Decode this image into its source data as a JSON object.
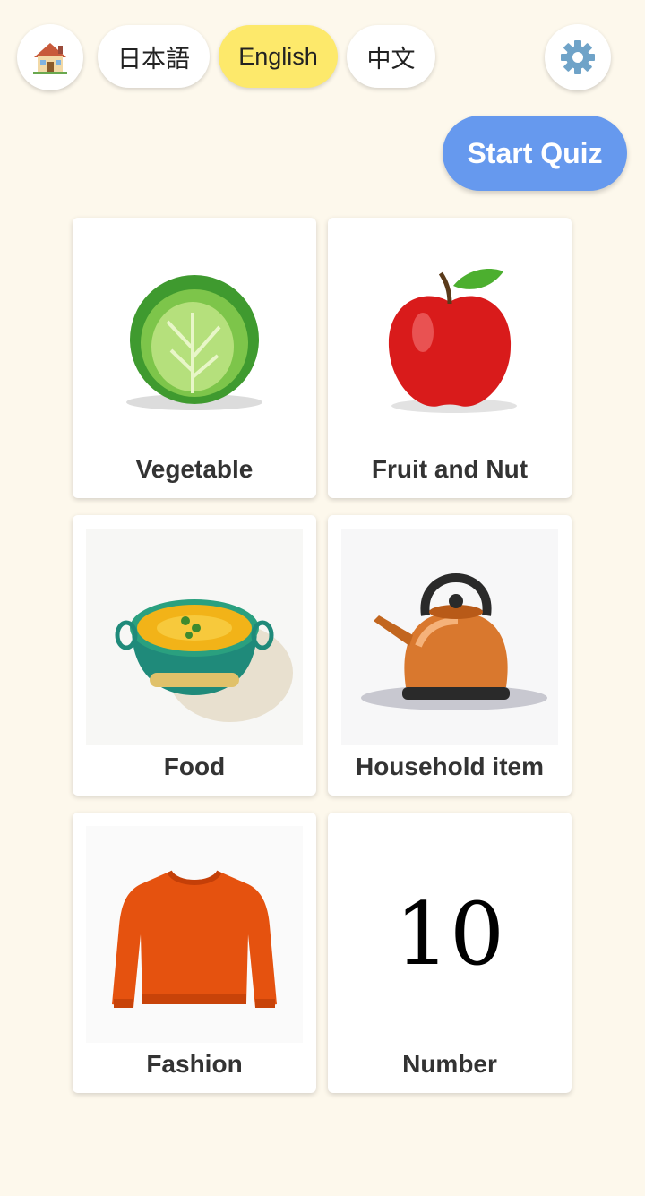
{
  "header": {
    "home_icon": "house-icon",
    "languages": [
      {
        "label": "日本語",
        "active": false
      },
      {
        "label": "English",
        "active": true
      },
      {
        "label": "中文",
        "active": false
      }
    ],
    "settings_icon": "gear-icon",
    "start_quiz_label": "Start Quiz"
  },
  "categories": [
    {
      "label": "Vegetable",
      "image": "cabbage-image"
    },
    {
      "label": "Fruit and Nut",
      "image": "apple-image"
    },
    {
      "label": "Food",
      "image": "soup-bowl-image"
    },
    {
      "label": "Household item",
      "image": "kettle-image"
    },
    {
      "label": "Fashion",
      "image": "sweater-image"
    },
    {
      "label": "Number",
      "image": "number-image",
      "glyph": "10"
    }
  ],
  "colors": {
    "background": "#fdf8ec",
    "active_language": "#fde96b",
    "accent": "#6699ee"
  }
}
